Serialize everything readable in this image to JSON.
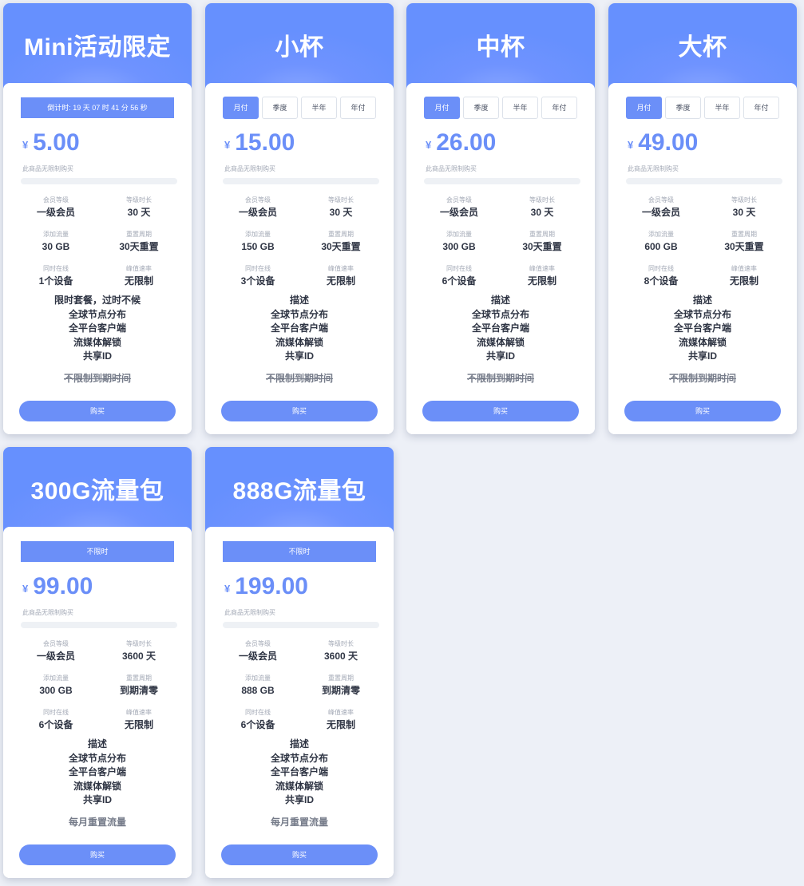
{
  "currency_symbol": "¥",
  "accent_color": "#6b8ff8",
  "stat_labels": {
    "level": "会员等级",
    "duration": "等级时长",
    "traffic": "添加流量",
    "reset_cycle": "重置周期",
    "devices": "同时在线",
    "speed": "峰值速率"
  },
  "period_tabs": [
    "月付",
    "季度",
    "半年",
    "年付"
  ],
  "purchase_note": "此商品无限制购买",
  "buy_label": "购买",
  "plans": [
    {
      "title": "Mini活动限定",
      "banner": "倒计时: 19 天 07 时 41 分 56 秒",
      "price": "5.00",
      "progress": 0,
      "level": "一级会员",
      "duration": "30 天",
      "traffic": "30 GB",
      "reset_cycle": "30天重置",
      "devices": "1个设备",
      "speed": "无限制",
      "description": [
        "限时套餐，过时不候",
        "全球节点分布",
        "全平台客户端",
        "流媒体解锁",
        "共享ID"
      ],
      "reset_text": "不限制到期时间"
    },
    {
      "title": "小杯",
      "active_period": "月付",
      "price": "15.00",
      "progress": 0,
      "level": "一级会员",
      "duration": "30 天",
      "traffic": "150 GB",
      "reset_cycle": "30天重置",
      "devices": "3个设备",
      "speed": "无限制",
      "description": [
        "描述",
        "全球节点分布",
        "全平台客户端",
        "流媒体解锁",
        "共享ID"
      ],
      "reset_text": "不限制到期时间"
    },
    {
      "title": "中杯",
      "active_period": "月付",
      "price": "26.00",
      "progress": 0,
      "level": "一级会员",
      "duration": "30 天",
      "traffic": "300 GB",
      "reset_cycle": "30天重置",
      "devices": "6个设备",
      "speed": "无限制",
      "description": [
        "描述",
        "全球节点分布",
        "全平台客户端",
        "流媒体解锁",
        "共享ID"
      ],
      "reset_text": "不限制到期时间"
    },
    {
      "title": "大杯",
      "active_period": "月付",
      "price": "49.00",
      "progress": 0,
      "level": "一级会员",
      "duration": "30 天",
      "traffic": "600 GB",
      "reset_cycle": "30天重置",
      "devices": "8个设备",
      "speed": "无限制",
      "description": [
        "描述",
        "全球节点分布",
        "全平台客户端",
        "流媒体解锁",
        "共享ID"
      ],
      "reset_text": "不限制到期时间"
    },
    {
      "title": "300G流量包",
      "banner": "不限时",
      "price": "99.00",
      "progress": 0,
      "level": "一级会员",
      "duration": "3600 天",
      "traffic": "300 GB",
      "reset_cycle": "到期清零",
      "devices": "6个设备",
      "speed": "无限制",
      "description": [
        "描述",
        "全球节点分布",
        "全平台客户端",
        "流媒体解锁",
        "共享ID"
      ],
      "reset_text": "每月重置流量"
    },
    {
      "title": "888G流量包",
      "banner": "不限时",
      "price": "199.00",
      "progress": 0,
      "level": "一级会员",
      "duration": "3600 天",
      "traffic": "888 GB",
      "reset_cycle": "到期清零",
      "devices": "6个设备",
      "speed": "无限制",
      "description": [
        "描述",
        "全球节点分布",
        "全平台客户端",
        "流媒体解锁",
        "共享ID"
      ],
      "reset_text": "每月重置流量"
    }
  ]
}
